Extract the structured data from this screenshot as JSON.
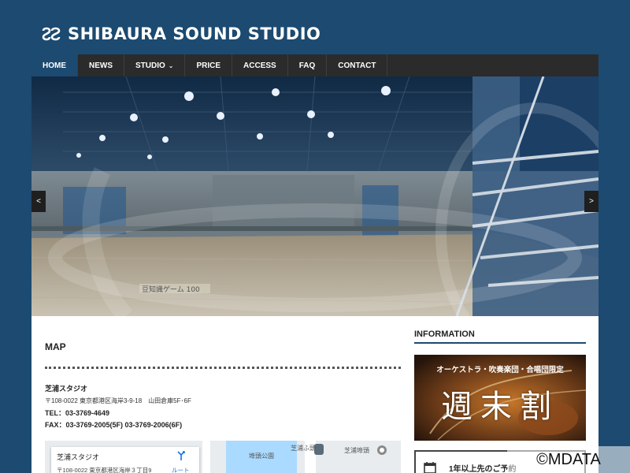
{
  "header": {
    "logo_text": "SHIBAURA SOUND STUDIO"
  },
  "nav": {
    "items": [
      {
        "label": "HOME"
      },
      {
        "label": "NEWS"
      },
      {
        "label": "STUDIO"
      },
      {
        "label": "PRICE"
      },
      {
        "label": "ACCESS"
      },
      {
        "label": "FAQ"
      },
      {
        "label": "CONTACT"
      }
    ],
    "studio_caret": "⌄"
  },
  "hero": {
    "prev_label": "<",
    "next_label": ">",
    "floor_sign": "豆知識ゲーム 100"
  },
  "main": {
    "map_title": "MAP",
    "studio_name": "芝浦スタジオ",
    "address": "〒108-0022 東京都港区海岸3-9-18　山田倉庫5F･6F",
    "tel": "TEL：03-3769-4649",
    "fax": "FAX：03-3769-2005(5F)  03-3769-2006(6F)",
    "map": {
      "card_name": "芝浦スタジオ",
      "card_address": "〒108-0022 東京都港区海岸３丁目9",
      "route_label": "ルート",
      "place_1": "埠頭公園",
      "place_2": "芝浦ふ頭",
      "place_3": "芝浦埠頭"
    }
  },
  "sidebar": {
    "info_title": "INFORMATION",
    "banner_top": "オーケストラ・吹奏楽団・合唱団限定",
    "banner_big": "週末割",
    "notice_text": "1年以上先のご予約"
  },
  "watermark": "©MDATA",
  "colors": {
    "background": "#1c4a70",
    "nav_bar": "#2b2b2b",
    "nav_active": "#1c4a70",
    "accent_rule": "#1c4a70"
  }
}
